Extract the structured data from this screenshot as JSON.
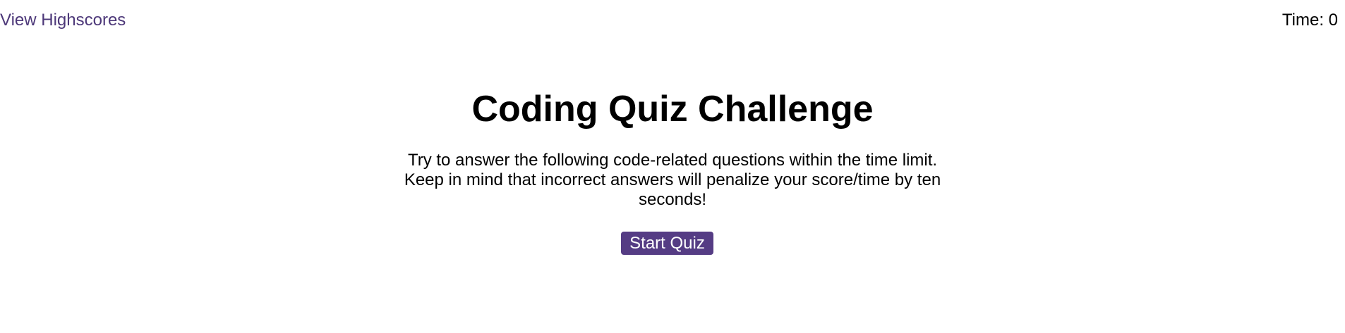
{
  "header": {
    "highscores_link": "View Highscores",
    "timer_label": "Time: 0"
  },
  "main": {
    "title": "Coding Quiz Challenge",
    "instructions": "Try to answer the following code-related questions within the time limit. Keep in mind that incorrect answers will penalize your score/time by ten seconds!",
    "start_button_label": "Start Quiz"
  },
  "colors": {
    "link": "#4d3879",
    "button_background": "#553c84",
    "button_text": "#ffffff",
    "background": "#ffffff"
  }
}
